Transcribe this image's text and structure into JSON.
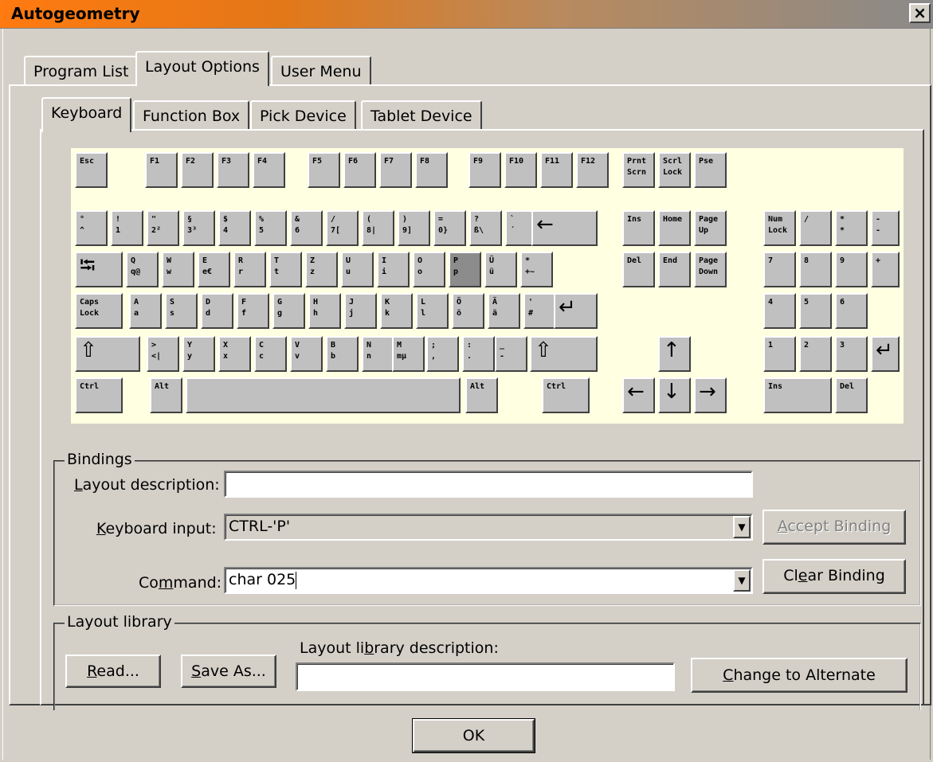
{
  "window": {
    "title": "Autogeometry",
    "close_label": "×"
  },
  "tabs": [
    "Program List",
    "Layout Options",
    "User Menu"
  ],
  "subtabs": [
    "Keyboard",
    "Function Box",
    "Pick Device",
    "Tablet Device"
  ],
  "keyboard": {
    "keys": {
      "esc": "Esc",
      "f1": "F1",
      "f2": "F2",
      "f3": "F3",
      "f4": "F4",
      "f5": "F5",
      "f6": "F6",
      "f7": "F7",
      "f8": "F8",
      "f9": "F9",
      "f10": "F10",
      "f11": "F11",
      "f12": "F12",
      "prnt": "Prnt\nScrn",
      "scrl": "Scrl\nLock",
      "pse": "Pse",
      "k_caret": "°\n^",
      "k1": "!\n1",
      "k2": "\"\n2²",
      "k3": "§\n3³",
      "k4": "$\n4",
      "k5": "%\n5",
      "k6": "&\n6",
      "k7": "/\n7[",
      "k8": "(\n8|",
      "k9": ")\n9]",
      "k0": "=\n0}",
      "k_ss": "?\nß\\",
      "k_acc": "`\n´",
      "ins": "Ins",
      "home": "Home",
      "pgup": "Page\nUp",
      "numlock": "Num\nLock",
      "np_div": "/",
      "np_mul": "*\n*",
      "np_sub": "-\n-",
      "q": "Q\nq@",
      "w": "W\nw",
      "e": "E\ne€",
      "r": "R\nr",
      "t": "T\nt",
      "z": "Z\nz",
      "u": "U\nu",
      "i": "I\ni",
      "o": "O\no",
      "p": "P\np",
      "ue": "Ü\nü",
      "plus": "*\n+~",
      "del": "Del",
      "end": "End",
      "pgdn": "Page\nDown",
      "np7": "7",
      "np8": "8",
      "np9": "9",
      "np_add": "+",
      "caps": "Caps\nLock",
      "a": "A\na",
      "s": "S\ns",
      "d": "D\nd",
      "f": "F\nf",
      "g": "G\ng",
      "h": "H\nh",
      "j": "J\nj",
      "k": "K\nk",
      "l": "L\nl",
      "oe": "Ö\nö",
      "ae": "Ä\nä",
      "hash": "'\n#",
      "np4": "4",
      "np5": "5",
      "np6": "6",
      "lt": ">\n<|",
      "y": "Y\ny",
      "x": "X\nx",
      "c": "C\nc",
      "v": "V\nv",
      "b": "B\nb",
      "n": "N\nn",
      "m": "M\nmµ",
      "comma": ";\n,",
      "period": ":\n.",
      "minus": "_\n-",
      "np1": "1",
      "np2": "2",
      "np3": "3",
      "lctrl": "Ctrl",
      "lalt": "Alt",
      "altgr": "Alt",
      "rctrl": "Ctrl",
      "np0": "Ins",
      "npdel": "Del"
    }
  },
  "bindings": {
    "group_label": "Bindings",
    "layout_description": {
      "label_pre": "",
      "label_ul": "L",
      "label_post": "ayout description:",
      "value": ""
    },
    "keyboard_input": {
      "label_pre": "",
      "label_ul": "K",
      "label_post": "eyboard input:",
      "value": "CTRL-'P'"
    },
    "command": {
      "label_pre": "Co",
      "label_ul": "m",
      "label_post": "mand:",
      "value": "char 025"
    },
    "accept": {
      "pre": "",
      "ul": "A",
      "post": "ccept Binding"
    },
    "clear": {
      "pre": "Cl",
      "ul": "e",
      "post": "ar Binding"
    }
  },
  "library": {
    "group_label": "Layout library",
    "description_label": {
      "pre": "Layout li",
      "ul": "b",
      "post": "rary description:"
    },
    "description_value": "",
    "read": {
      "pre": "",
      "ul": "R",
      "post": "ead..."
    },
    "save_as": {
      "pre": "",
      "ul": "S",
      "post": "ave As..."
    },
    "change": {
      "pre": "",
      "ul": "C",
      "post": "hange to Alternate"
    }
  },
  "ok_label": "OK"
}
